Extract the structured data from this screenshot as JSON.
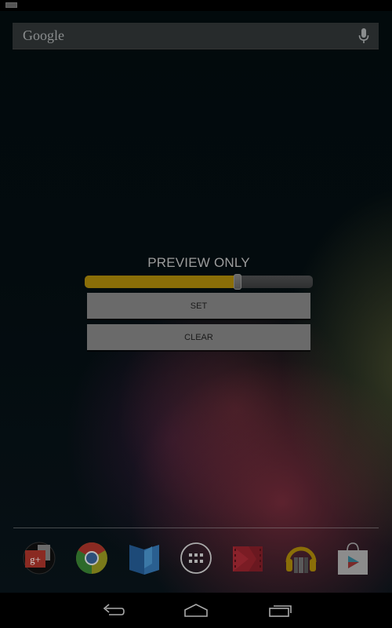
{
  "status_bar": {
    "notification_icon": "notification-icon"
  },
  "search_widget": {
    "label": "Google",
    "voice_icon": "mic-icon"
  },
  "dialog": {
    "title": "PREVIEW ONLY",
    "slider": {
      "value_fraction": 0.67,
      "fill_color": "#8a6e08"
    },
    "buttons": {
      "set_label": "SET",
      "clear_label": "CLEAR"
    }
  },
  "dock": {
    "apps": [
      {
        "name": "Google+ folder",
        "icon": "google-plus-folder-icon"
      },
      {
        "name": "Chrome",
        "icon": "chrome-icon"
      },
      {
        "name": "Play Books",
        "icon": "play-books-icon"
      },
      {
        "name": "All Apps",
        "icon": "app-drawer-icon"
      },
      {
        "name": "Play Movies",
        "icon": "play-movies-icon"
      },
      {
        "name": "Play Music",
        "icon": "play-music-icon"
      },
      {
        "name": "Play Store",
        "icon": "play-store-icon"
      }
    ]
  },
  "nav_bar": {
    "back": "back-icon",
    "home": "home-icon",
    "recents": "recents-icon"
  }
}
